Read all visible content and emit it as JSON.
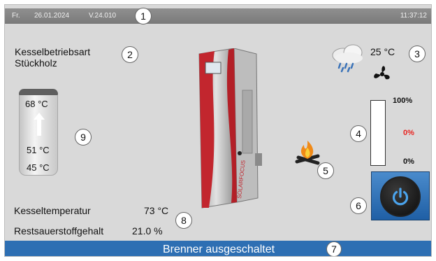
{
  "topbar": {
    "day": "Fr.",
    "date": "26.01.2024",
    "version": "V.24.010",
    "time": "11:37:12"
  },
  "mode": {
    "title": "Kesselbetriebsart",
    "value": "Stückholz"
  },
  "weather": {
    "temperature": "25 °C",
    "icon": "weather-cloud-rain-icon"
  },
  "fan": {
    "icon": "fan-icon"
  },
  "boiler": {
    "icon": "boiler-image",
    "brand": "SOLARFOCUS"
  },
  "flame": {
    "icon": "flame-icon"
  },
  "buffer": {
    "top_temp": "68 °C",
    "mid_temp": "51 °C",
    "bottom_temp": "45 °C"
  },
  "power": {
    "max_label": "100%",
    "value_label": "0%",
    "min_label": "0%",
    "value": 0,
    "accent": "#e8231f"
  },
  "readings": {
    "boiler_temp_label": "Kesseltemperatur",
    "boiler_temp_value": "73 °C",
    "oxygen_label": "Restsauerstoffgehalt",
    "oxygen_value": "21.0 %"
  },
  "power_button": {
    "icon": "power-icon"
  },
  "status": {
    "text": "Brenner ausgeschaltet"
  },
  "callouts": [
    "1",
    "2",
    "3",
    "4",
    "5",
    "6",
    "7",
    "8",
    "9"
  ]
}
